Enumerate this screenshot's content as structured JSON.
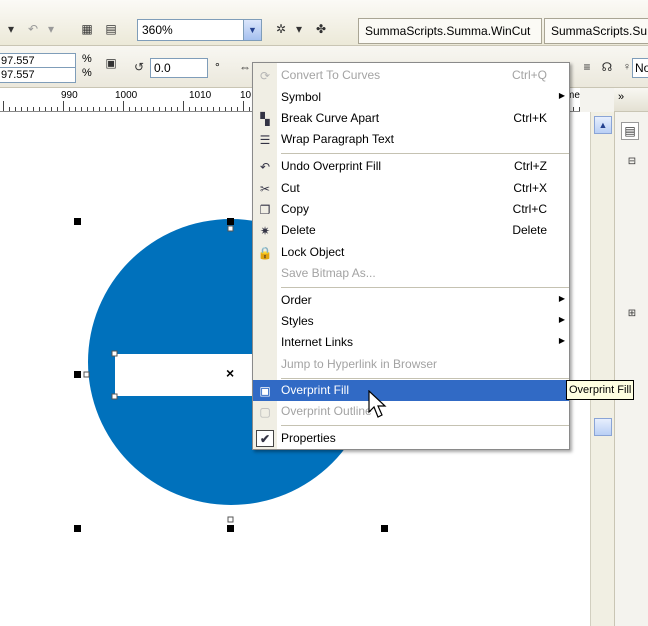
{
  "toolbar": {
    "zoom_value": "360%",
    "tabs": [
      "SummaScripts.Summa.WinCut",
      "SummaScripts.Su"
    ],
    "pos_x": "97.557",
    "pos_y": "97.557",
    "pct_symbol": "%",
    "rotation": "0.0",
    "degree": "°",
    "font_prefix": "No"
  },
  "ruler": {
    "labels": [
      "990",
      "1000",
      "1010",
      "10"
    ],
    "unit": "meters"
  },
  "menu": {
    "items": [
      {
        "label": "Convert To Curves",
        "shortcut": "Ctrl+Q",
        "disabled": true,
        "icon": "convert-curves-icon"
      },
      {
        "label": "Symbol",
        "submenu": true,
        "icon": ""
      },
      {
        "label": "Break Curve Apart",
        "shortcut": "Ctrl+K",
        "icon": "break-apart-icon"
      },
      {
        "label": "Wrap Paragraph Text",
        "icon": "wrap-text-icon"
      },
      {
        "label": "Undo Overprint Fill",
        "shortcut": "Ctrl+Z",
        "icon": "undo-icon"
      },
      {
        "label": "Cut",
        "shortcut": "Ctrl+X",
        "icon": "scissors-icon"
      },
      {
        "label": "Copy",
        "shortcut": "Ctrl+C",
        "icon": "copy-icon"
      },
      {
        "label": "Delete",
        "shortcut": "Delete",
        "icon": "delete-icon"
      },
      {
        "label": "Lock Object",
        "icon": "lock-icon"
      },
      {
        "label": "Save Bitmap As...",
        "disabled": true,
        "icon": ""
      },
      {
        "label": "Order",
        "submenu": true,
        "icon": ""
      },
      {
        "label": "Styles",
        "submenu": true,
        "icon": ""
      },
      {
        "label": "Internet Links",
        "submenu": true,
        "icon": ""
      },
      {
        "label": "Jump to Hyperlink in Browser",
        "disabled": true,
        "icon": ""
      },
      {
        "label": "Overprint Fill",
        "highlighted": true,
        "icon": "overprint-fill-icon"
      },
      {
        "label": "Overprint Outline",
        "disabled": true,
        "icon": "overprint-outline-icon"
      },
      {
        "label": "Properties",
        "icon": "checkmark-icon"
      }
    ]
  },
  "tooltip": "Overprint Fill",
  "canvas": {
    "center_mark": "×",
    "circle_color": "#0071bc"
  },
  "docker": {
    "arrow": "»"
  }
}
